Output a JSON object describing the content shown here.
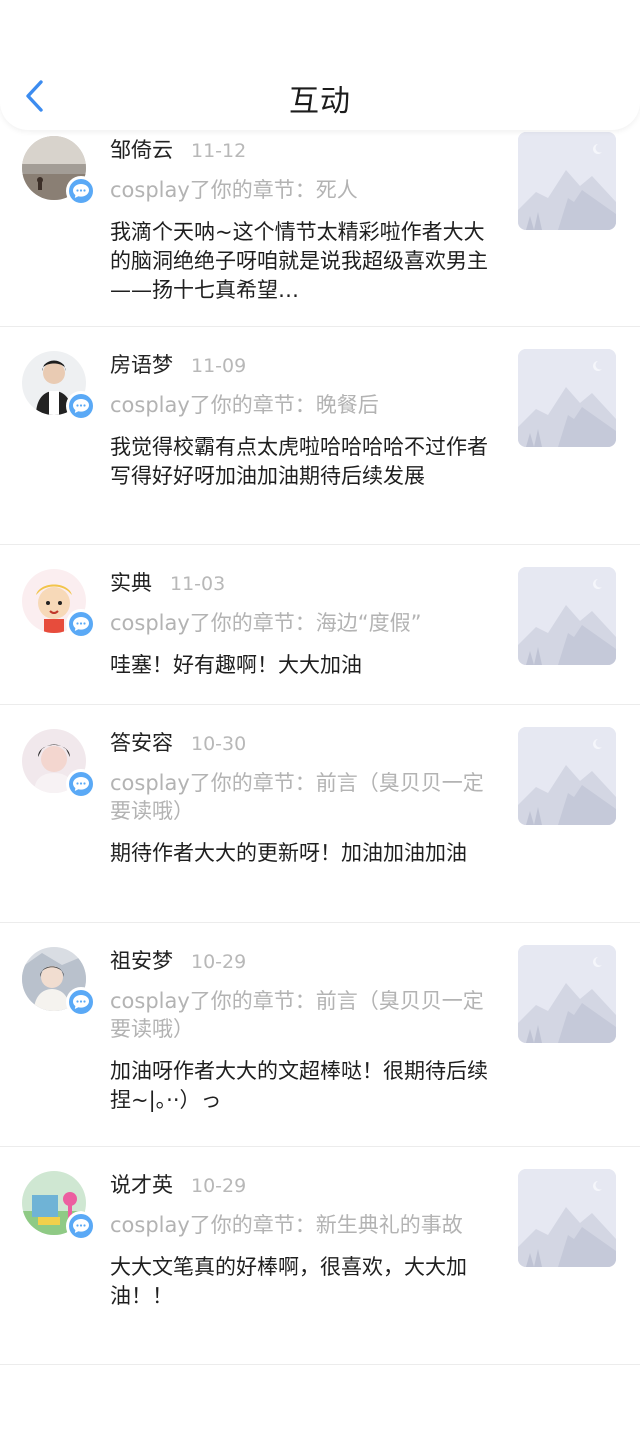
{
  "header": {
    "title": "互动",
    "back_icon": "chevron-left-icon"
  },
  "accent_color": "#5aa9f6",
  "items": [
    {
      "name": "邹倚云",
      "date": "11-12",
      "chapter": "cosplay了你的章节：死人",
      "comment": "我滴个天呐~这个情节太精彩啦作者大大的脑洞绝绝子呀咱就是说我超级喜欢男主——扬十七真希望…"
    },
    {
      "name": "房语梦",
      "date": "11-09",
      "chapter": "cosplay了你的章节：晚餐后",
      "comment": "我觉得校霸有点太虎啦哈哈哈哈不过作者写得好好呀加油加油期待后续发展"
    },
    {
      "name": "实典",
      "date": "11-03",
      "chapter": "cosplay了你的章节：海边“度假”",
      "comment": "哇塞！好有趣啊！大大加油"
    },
    {
      "name": "答安容",
      "date": "10-30",
      "chapter": "cosplay了你的章节：前言（臭贝贝一定要读哦）",
      "comment": "期待作者大大的更新呀！加油加油加油"
    },
    {
      "name": "祖安梦",
      "date": "10-29",
      "chapter": "cosplay了你的章节：前言（臭贝贝一定要读哦）",
      "comment": "加油呀作者大大的文超棒哒！很期待后续捏~|。··）っ"
    },
    {
      "name": "说才英",
      "date": "10-29",
      "chapter": "cosplay了你的章节：新生典礼的事故",
      "comment": "大大文笔真的好棒啊，很喜欢，大大加油！！"
    }
  ]
}
